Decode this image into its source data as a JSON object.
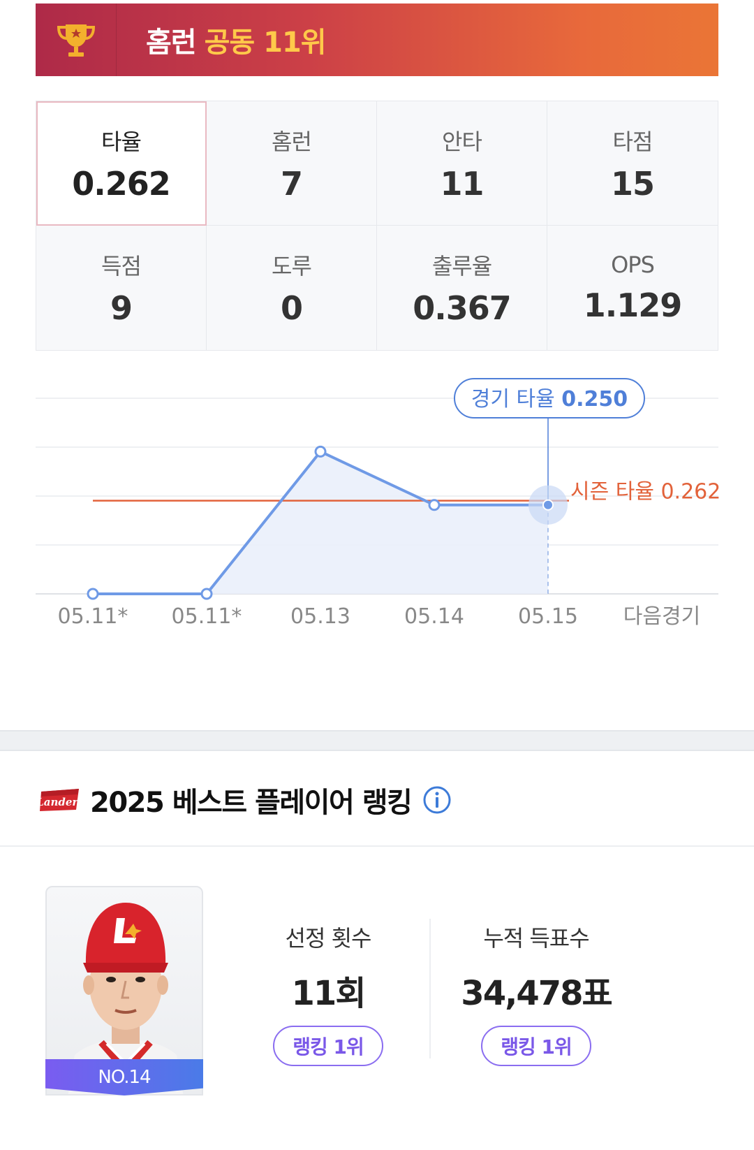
{
  "banner": {
    "prefix": "홈런",
    "highlight": "공동 11위",
    "icon": "trophy-icon",
    "accent": "#ffc94a"
  },
  "stats": [
    {
      "label": "타율",
      "value": "0.262",
      "active": true
    },
    {
      "label": "홈런",
      "value": "7"
    },
    {
      "label": "안타",
      "value": "11"
    },
    {
      "label": "타점",
      "value": "15"
    },
    {
      "label": "득점",
      "value": "9"
    },
    {
      "label": "도루",
      "value": "0"
    },
    {
      "label": "출루율",
      "value": "0.367"
    },
    {
      "label": "OPS",
      "value": "1.129"
    }
  ],
  "chart_data": {
    "type": "line",
    "categories": [
      "05.11*",
      "05.11*",
      "05.13",
      "05.14",
      "05.15",
      "다음경기"
    ],
    "series": [
      {
        "name": "경기 타율",
        "values": [
          0.0,
          0.0,
          0.4,
          0.25,
          0.25,
          null
        ]
      }
    ],
    "reference_line": {
      "label": "시즌 타율 0.262",
      "value": 0.262
    },
    "tooltip": {
      "label": "경기 타율",
      "value": "0.250",
      "category": "05.15"
    },
    "ylim": [
      0,
      0.55
    ],
    "grid": true,
    "colors": {
      "line": "#6f9ae6",
      "reference": "#e2623a",
      "tooltip": "#4f7fd8"
    }
  },
  "ranking": {
    "title": "2025 베스트 플레이어 랭킹",
    "logo": "landers-logo",
    "info_icon": "info-icon",
    "player_no": "NO.14",
    "metrics": [
      {
        "label": "선정 횟수",
        "value": "11회",
        "rank": "랭킹 1위"
      },
      {
        "label": "누적 득표수",
        "value": "34,478표",
        "rank": "랭킹 1위"
      }
    ]
  }
}
